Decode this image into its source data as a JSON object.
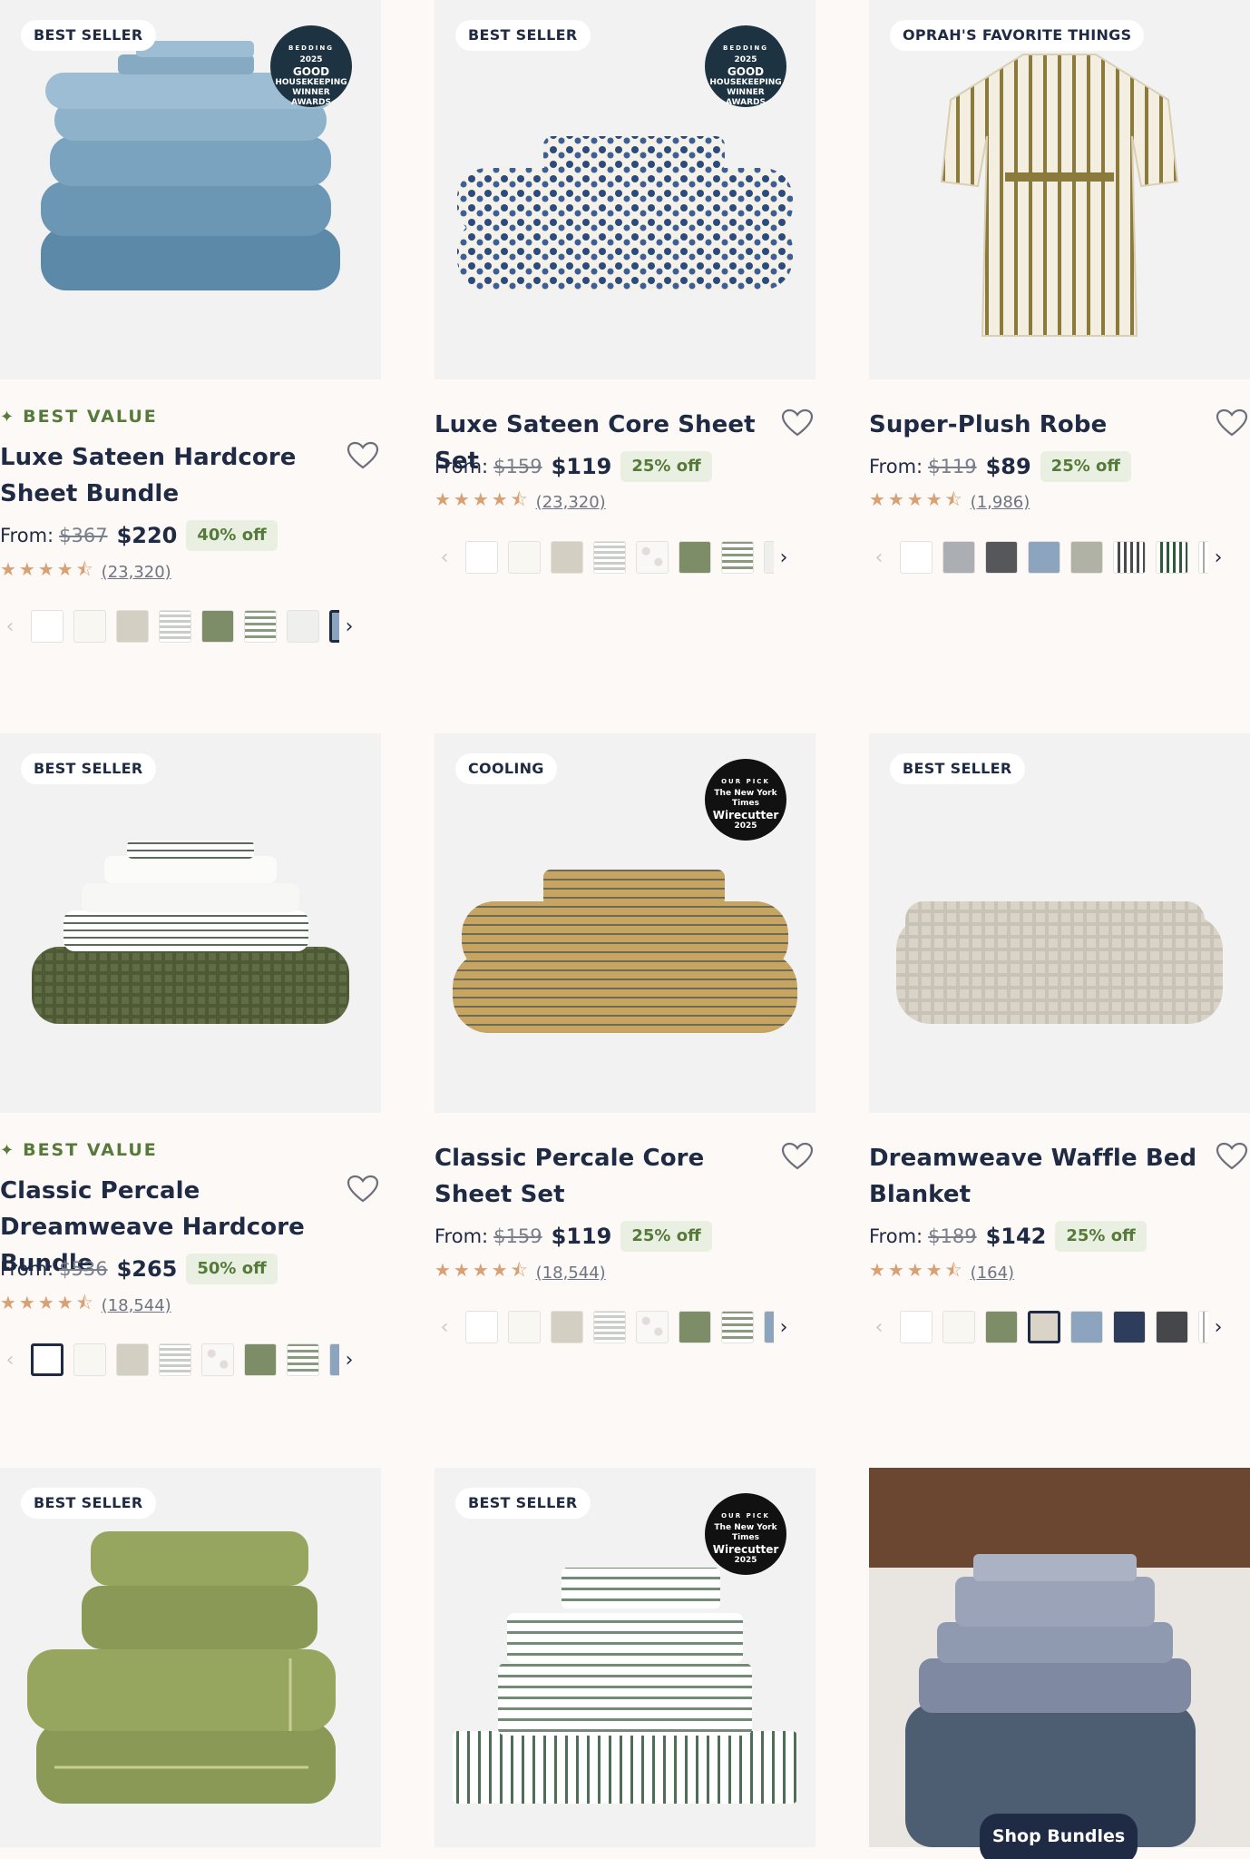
{
  "products": [
    {
      "badge": "BEST SELLER",
      "award": {
        "top": "BEDDING",
        "line1": "2025",
        "line2": "GOOD",
        "line3": "HOUSEKEEPING",
        "line4": "WINNER",
        "line5": "AWARDS"
      },
      "tag": "BEST VALUE",
      "title": "Luxe Sateen Hardcore Sheet Bundle",
      "price_label": "From:",
      "was": "$367",
      "now": "$220",
      "off": "40% off",
      "reviews": "(23,320)",
      "rating": 4.5
    },
    {
      "badge": "BEST SELLER",
      "award": {
        "top": "BEDDING",
        "line1": "2025",
        "line2": "GOOD",
        "line3": "HOUSEKEEPING",
        "line4": "WINNER",
        "line5": "AWARDS"
      },
      "title": "Luxe Sateen Core Sheet Set",
      "price_label": "From:",
      "was": "$159",
      "now": "$119",
      "off": "25% off",
      "reviews": "(23,320)",
      "rating": 4.5
    },
    {
      "badge": "OPRAH'S FAVORITE THINGS",
      "title": "Super-Plush Robe",
      "price_label": "From:",
      "was": "$119",
      "now": "$89",
      "off": "25% off",
      "reviews": "(1,986)",
      "rating": 4.5
    },
    {
      "badge": "BEST SELLER",
      "tag": "BEST VALUE",
      "title": "Classic Percale Dreamweave Hardcore Bundle",
      "price_label": "From:",
      "was": "$536",
      "now": "$265",
      "off": "50% off",
      "reviews": "(18,544)",
      "rating": 4.5
    },
    {
      "badge": "COOLING",
      "award": {
        "top": "OUR PICK",
        "line1": "The New York Times",
        "line2": "Wirecutter",
        "line3": "2025"
      },
      "title": "Classic Percale Core Sheet Set",
      "price_label": "From:",
      "was": "$159",
      "now": "$119",
      "off": "25% off",
      "reviews": "(18,544)",
      "rating": 4.5
    },
    {
      "badge": "BEST SELLER",
      "title": "Dreamweave Waffle Bed Blanket",
      "price_label": "From:",
      "was": "$189",
      "now": "$142",
      "off": "25% off",
      "reviews": "(164)",
      "rating": 4.5
    },
    {
      "badge": "BEST SELLER"
    },
    {
      "badge": "BEST SELLER",
      "award": {
        "top": "OUR PICK",
        "line1": "The New York Times",
        "line2": "Wirecutter",
        "line3": "2025"
      }
    },
    {
      "button": "Shop Bundles"
    }
  ],
  "icons": {
    "heart": "heart-outline-icon",
    "prev": "chevron-left-icon",
    "next": "chevron-right-icon",
    "stars": "star-icon",
    "sparkle": "sparkle-icon"
  },
  "colors": {
    "navy": "#1f2a44",
    "green_accent": "#567a3a",
    "off_bg": "#e9f0e1",
    "star": "#d9a173",
    "page_bg": "#fcf9f6"
  }
}
